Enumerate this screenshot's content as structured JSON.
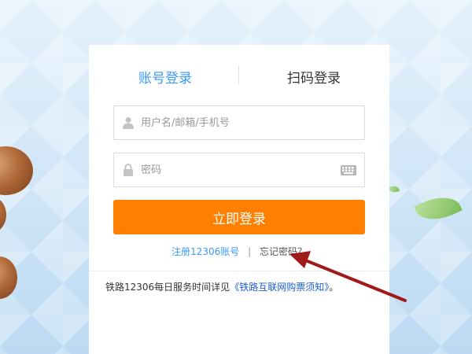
{
  "login": {
    "tabs": [
      {
        "label": "账号登录"
      },
      {
        "label": "扫码登录"
      }
    ],
    "username_placeholder": "用户名/邮箱/手机号",
    "password_placeholder": "密码",
    "login_button": "立即登录",
    "register_link": "注册12306账号",
    "separator": "|",
    "forgot_link": "忘记密码？",
    "notice_text": "铁路12306每日服务时间详见",
    "notice_link": "《铁路互联网购票须知》",
    "notice_end": "。"
  },
  "colors": {
    "active_tab": "#3b99fc",
    "login_button": "#ff8000",
    "annotation_arrow": "#a11a1a"
  },
  "icons": {
    "username": "user-icon",
    "password": "lock-icon",
    "keyboard": "keyboard-icon"
  }
}
